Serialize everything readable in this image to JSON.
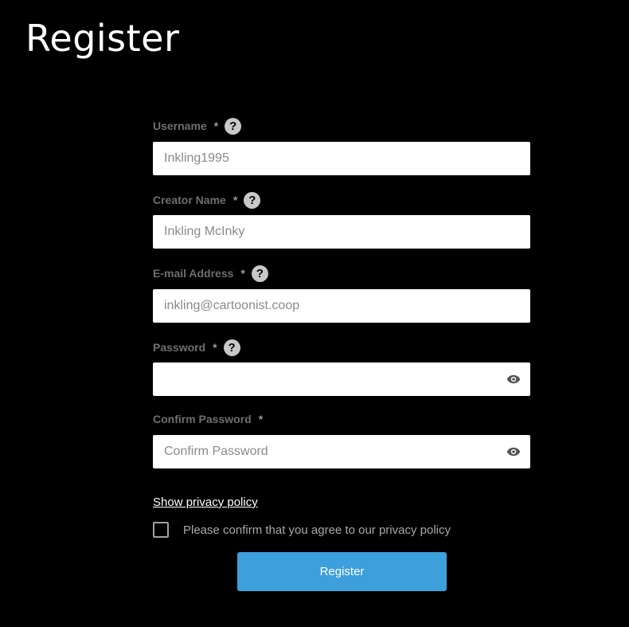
{
  "page": {
    "title": "Register"
  },
  "form": {
    "required_marker": "*",
    "help_glyph": "?",
    "username": {
      "label": "Username",
      "placeholder": "Inkling1995",
      "value": ""
    },
    "creator_name": {
      "label": "Creator Name",
      "placeholder": "Inkling McInky",
      "value": ""
    },
    "email": {
      "label": "E-mail Address",
      "placeholder": "inkling@cartoonist.coop",
      "value": ""
    },
    "password": {
      "label": "Password",
      "placeholder": "",
      "value": ""
    },
    "confirm_password": {
      "label": "Confirm Password",
      "placeholder": "Confirm Password",
      "value": ""
    },
    "privacy_link": "Show privacy policy",
    "consent_label": "Please confirm that you agree to our privacy policy",
    "consent_checked": false,
    "submit_label": "Register"
  },
  "icons": {
    "help": "question-circle-icon",
    "visibility_toggle": "eye-icon"
  },
  "colors": {
    "background": "#000000",
    "label": "#6e6e6e",
    "help_icon": "#c8c8c8",
    "button": "#3d9fdc",
    "link": "#ffffff"
  }
}
